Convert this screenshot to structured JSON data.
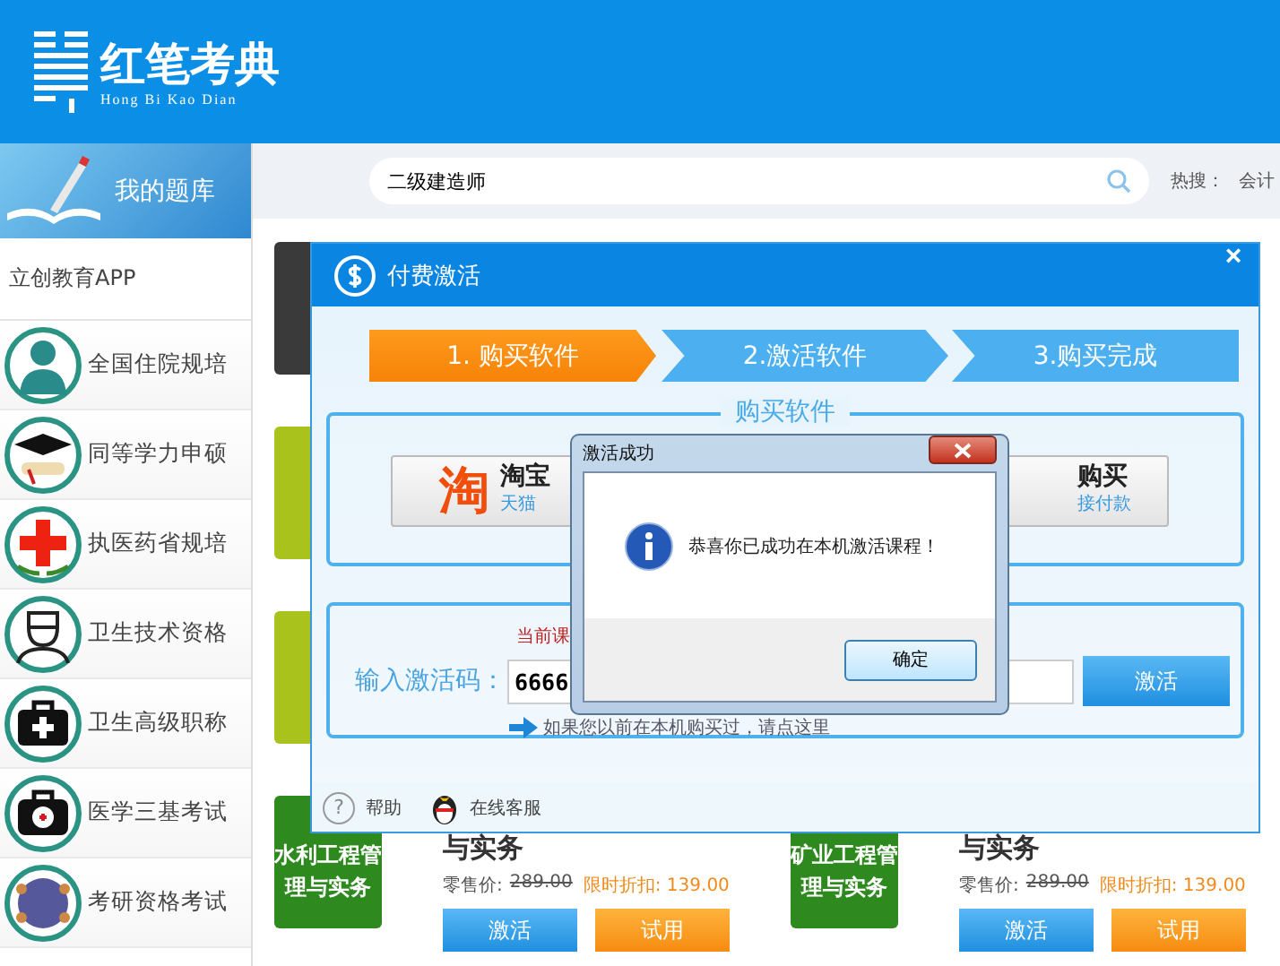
{
  "header": {
    "logo_title": "红笔考典",
    "logo_subtitle": "Hong Bi Kao Dian"
  },
  "sidebar": {
    "title": "我的题库",
    "app_link": "立创教育APP",
    "items": [
      {
        "label": "全国住院规培"
      },
      {
        "label": "同等学力申硕"
      },
      {
        "label": "执医药省规培"
      },
      {
        "label": "卫生技术资格"
      },
      {
        "label": "卫生高级职称"
      },
      {
        "label": "医学三基考试"
      },
      {
        "label": "考研资格考试"
      }
    ]
  },
  "search": {
    "value": "二级建造师",
    "hot_label": "热搜：",
    "hot_terms": [
      "会计"
    ]
  },
  "course_rows": [
    {
      "kind": "covered",
      "color": "#3a3a3a"
    },
    {
      "kind": "covered",
      "color": "#a9c21c"
    },
    {
      "kind": "covered",
      "color": "#a9c21c"
    },
    {
      "kind": "full",
      "cards": [
        {
          "color": "#2e8a1e",
          "tile_title": "水利工程管理与实务",
          "title": "与实务",
          "retail_label": "零售价:",
          "retail_price": "289.00",
          "discount": "限时折扣: 139.00",
          "activate": "激活",
          "trial": "试用"
        },
        {
          "color": "#2e8a1e",
          "tile_title": "矿业工程管理与实务",
          "title": "与实务",
          "retail_label": "零售价:",
          "retail_price": "289.00",
          "discount": "限时折扣: 139.00",
          "activate": "激活",
          "trial": "试用"
        }
      ]
    }
  ],
  "pay_dialog": {
    "title": "付费激活",
    "close": "×",
    "steps": [
      {
        "label": "1. 购买软件",
        "selected": true
      },
      {
        "label": "2.激活软件",
        "selected": false
      },
      {
        "label": "3.购买完成",
        "selected": false
      }
    ],
    "buy_section": {
      "legend": "购买软件",
      "taobao_icon": "淘",
      "taobao_title": "淘宝",
      "taobao_sub": "天猫",
      "direct_title": "购买",
      "direct_sub": "接付款"
    },
    "activate_section": {
      "notice": "当前课",
      "code_label": "输入激活码：",
      "code_value": "6666",
      "button": "激活",
      "link": "如果您以前在本机购买过，请点这里"
    },
    "footer": {
      "help_icon": "?",
      "help": "帮助",
      "service": "在线客服"
    }
  },
  "message_box": {
    "title": "激活成功",
    "message": "恭喜你已成功在本机激活课程！",
    "ok": "确定"
  }
}
